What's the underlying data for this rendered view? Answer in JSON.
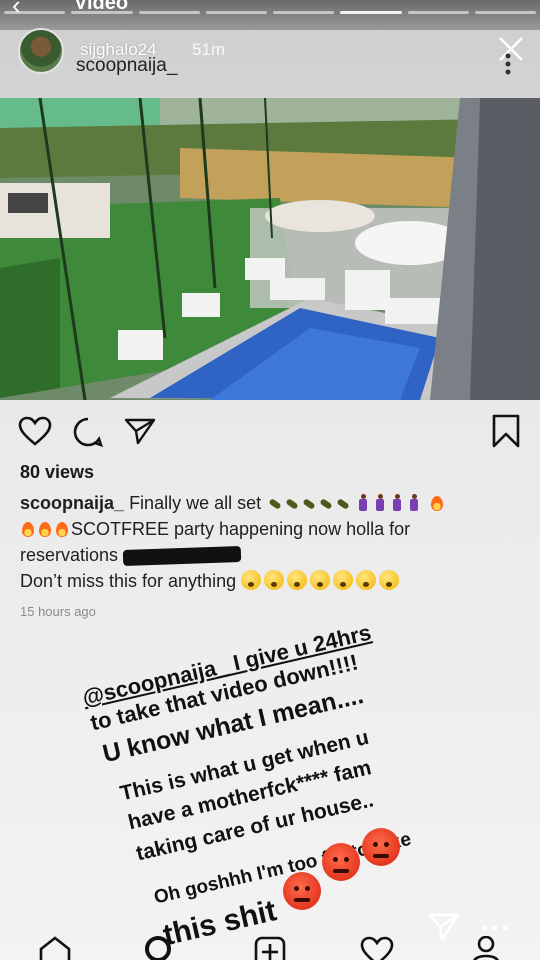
{
  "story": {
    "top_title": "Video",
    "progress_segments": 8,
    "current_segment": 6,
    "author": "sijghalo24",
    "time": "51m"
  },
  "post": {
    "username": "scoopnaija_",
    "views": "80 views",
    "caption_user": "scoopnaija_",
    "caption_line1": "Finally we all set",
    "caption_line2": "SCOTFREE party happening now  holla for",
    "caption_line3": "reservations",
    "caption_line4": "Don’t miss this for anything",
    "time_ago": "15 hours ago"
  },
  "overlay": {
    "line1": "@scoopnaija_ I give u 24hrs",
    "line2": "to take that video down!!!!",
    "line3": "U know what I mean....",
    "line4": "This is what u get when u",
    "line5": "have a motherfck**** fam",
    "line6": "taking care of ur house..",
    "line7": "Oh goshhh I'm too far to take",
    "line8": "this shit"
  },
  "icons": {
    "like": "heart-icon",
    "comment": "comment-icon",
    "share": "send-icon",
    "save": "bookmark-icon",
    "close": "close-icon",
    "more": "more-vertical-icon",
    "reply": "send-icon",
    "home": "home-icon",
    "search": "search-icon",
    "add": "add-icon",
    "activity": "heart-icon",
    "profile": "profile-icon"
  },
  "colors": {
    "angry_emoji": "#d8200e",
    "pool": "#2f63c4",
    "grass": "#3f8a3a"
  }
}
